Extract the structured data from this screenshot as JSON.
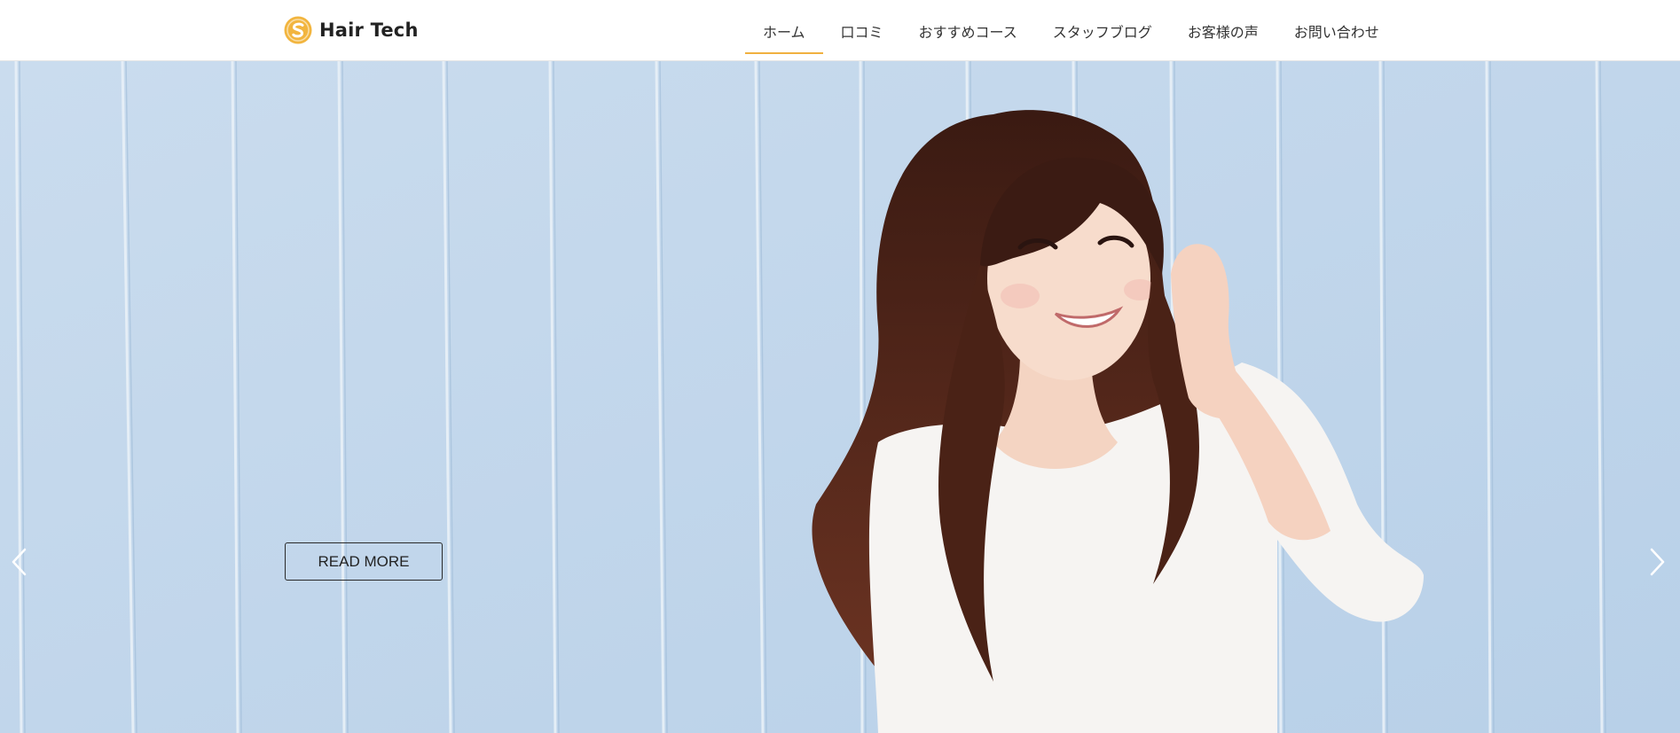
{
  "header": {
    "logo_text": "Hair Tech",
    "logo_icon": "s-circle-logo-icon",
    "accent_color": "#f0b040"
  },
  "nav": {
    "items": [
      {
        "label": "ホーム",
        "active": true
      },
      {
        "label": "口コミ",
        "active": false
      },
      {
        "label": "おすすめコース",
        "active": false
      },
      {
        "label": "スタッフブログ",
        "active": false
      },
      {
        "label": "お客様の声",
        "active": false
      },
      {
        "label": "お問い合わせ",
        "active": false
      }
    ]
  },
  "hero": {
    "button_label": "READ MORE",
    "prev_icon": "chevron-left-icon",
    "next_icon": "chevron-right-icon",
    "background_color": "#c9dced"
  }
}
